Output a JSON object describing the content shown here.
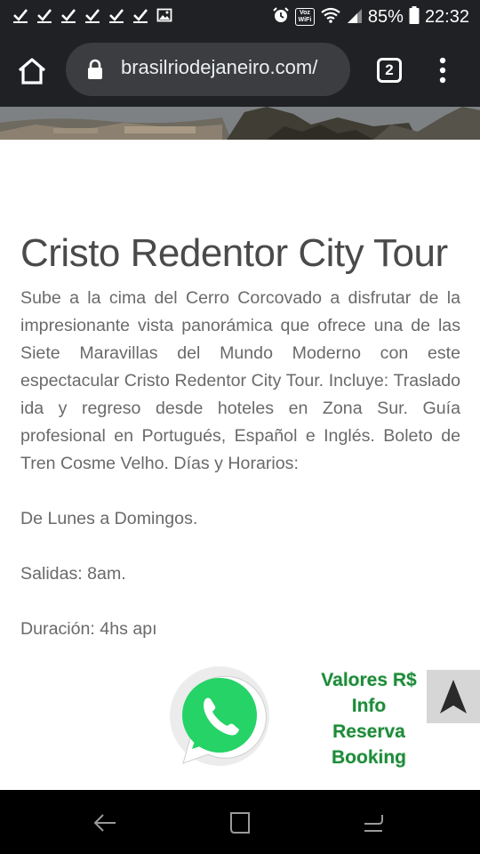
{
  "status_bar": {
    "notification_icons": [
      "check-icon",
      "check-icon",
      "check-icon",
      "check-icon",
      "check-icon",
      "check-icon",
      "image-icon"
    ],
    "vowifi_label": "Voz WiFi",
    "battery_percent": "85%",
    "time": "22:32"
  },
  "browser": {
    "url": "brasilriodejaneiro.com/",
    "tab_count": "2"
  },
  "article": {
    "title": "Cristo Redentor City Tour",
    "description": "Sube a la cima del Cerro Corcovado a disfrutar de la impresionante vista panorámica que ofrece una de las Siete Maravillas del Mundo Moderno con este espectacular Cristo Redentor City Tour. Incluye: Traslado ida y regreso desde hoteles en Zona Sur. Guía profesional en Portugués, Español e Inglés. Boleto de Tren Cosme Velho. Días y Horarios:",
    "days": "De Lunes a Domingos.",
    "departures": "Salidas: 8am.",
    "duration": "Duración: 4hs apı"
  },
  "booking_labels": [
    "Valores R$",
    "Info",
    "Reserva",
    "Booking"
  ],
  "colors": {
    "chrome_dark": "#202124",
    "url_pill": "#3c3d40",
    "whatsapp_green": "#25d366",
    "booking_green": "#1f8a3a",
    "text_gray": "#6a6a6a"
  }
}
